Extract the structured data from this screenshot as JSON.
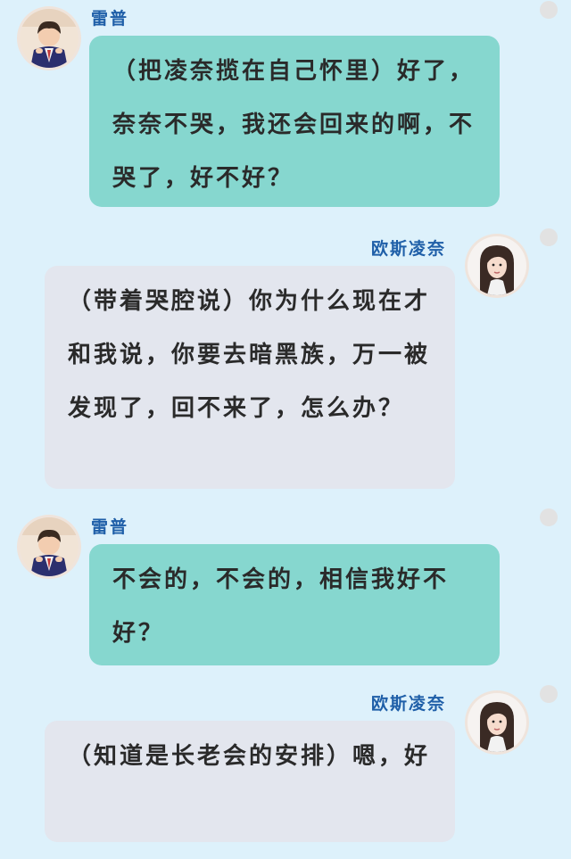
{
  "colors": {
    "background": "#ddf1fb",
    "left_bubble": "#86d7cf",
    "right_bubble": "#e3e6ee",
    "name": "#1f5fa8"
  },
  "messages": [
    {
      "sender": "雷普",
      "side": "left",
      "avatar_icon": "boy-avatar-icon",
      "text": "（把凌奈揽在自己怀里）好了，奈奈不哭，我还会回来的啊，不哭了，好不好？"
    },
    {
      "sender": "欧斯凌奈",
      "side": "right",
      "avatar_icon": "girl-avatar-icon",
      "text": "（带着哭腔说）你为什么现在才和我说，你要去暗黑族，万一被发现了，回不来了，怎么办？"
    },
    {
      "sender": "雷普",
      "side": "left",
      "avatar_icon": "boy-avatar-icon",
      "text": "不会的，不会的，相信我好不好？"
    },
    {
      "sender": "欧斯凌奈",
      "side": "right",
      "avatar_icon": "girl-avatar-icon",
      "text": "（知道是长老会的安排）嗯，好"
    }
  ]
}
